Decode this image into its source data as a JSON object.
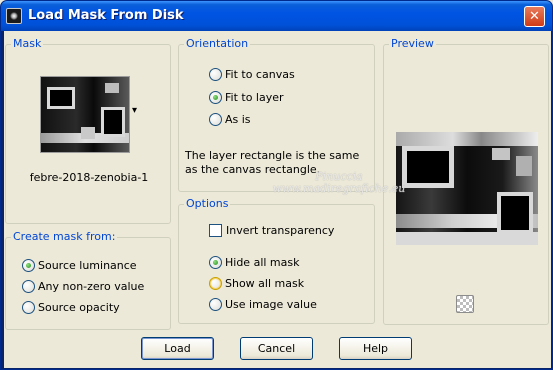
{
  "window": {
    "title": "Load Mask From Disk",
    "close_glyph": "✕"
  },
  "mask_group": {
    "label": "Mask",
    "filename": "febre-2018-zenobia-1",
    "dropdown_glyph": "▾"
  },
  "create_mask": {
    "label": "Create mask from:",
    "options": [
      {
        "label": "Source luminance",
        "selected": true
      },
      {
        "label": "Any non-zero value",
        "selected": false
      },
      {
        "label": "Source opacity",
        "selected": false
      }
    ]
  },
  "orientation": {
    "label": "Orientation",
    "options": [
      {
        "label": "Fit to canvas",
        "selected": false
      },
      {
        "label": "Fit to layer",
        "selected": true
      },
      {
        "label": "As is",
        "selected": false
      }
    ],
    "description": "The layer rectangle is the same as the canvas rectangle."
  },
  "options": {
    "label": "Options",
    "invert_label": "Invert transparency",
    "invert_checked": false,
    "radios": [
      {
        "label": "Hide all mask",
        "selected": true
      },
      {
        "label": "Show all mask",
        "selected": false
      },
      {
        "label": "Use image value",
        "selected": false
      }
    ]
  },
  "preview": {
    "label": "Preview"
  },
  "watermark": {
    "line1": "Pinuccia",
    "line2": "www.madiregrafiche.eu"
  },
  "buttons": {
    "load": "Load",
    "cancel": "Cancel",
    "help": "Help"
  }
}
